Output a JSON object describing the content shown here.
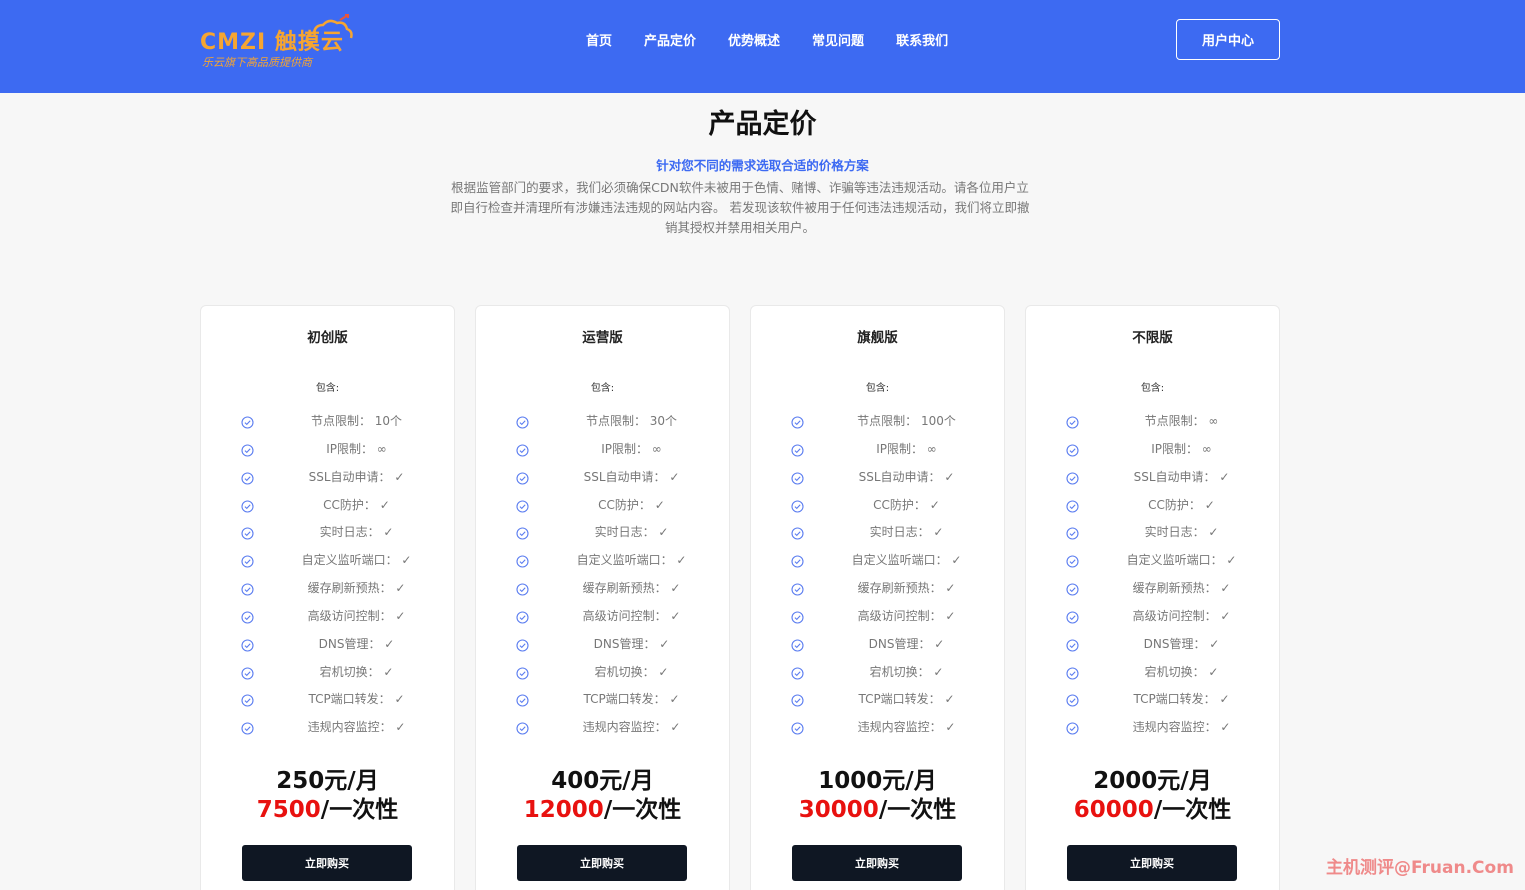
{
  "header": {
    "logo_text": "CMZI 触摸云",
    "logo_slogan": "乐云旗下高品质提供商",
    "nav": [
      "首页",
      "产品定价",
      "优势概述",
      "常见问题",
      "联系我们"
    ],
    "user_center": "用户中心",
    "bg_color": "#3d6af2"
  },
  "main": {
    "title": "产品定价",
    "subtitle": "针对您不同的需求选取合适的价格方案",
    "notice": "根据监管部门的要求，我们必须确保CDN软件未被用于色情、赌博、诈骗等违法违规活动。请各位用户立即自行检查并清理所有涉嫌违法违规的网站内容。 若发现该软件被用于任何违法违规活动，我们将立即撤销其授权并禁用相关用户。"
  },
  "plans": [
    {
      "name": "初创版",
      "contains": "包含:",
      "features": [
        "节点限制： 10个",
        "IP限制： ∞",
        "SSL自动申请： ✓",
        "CC防护： ✓",
        "实时日志： ✓",
        "自定义监听端口： ✓",
        "缓存刷新预热： ✓",
        "高级访问控制： ✓",
        "DNS管理： ✓",
        "宕机切换： ✓",
        "TCP端口转发： ✓",
        "违规内容监控： ✓"
      ],
      "price_month": "250元/月",
      "price_once_num": "7500",
      "price_once_suffix": "/一次性",
      "buy": "立即购买"
    },
    {
      "name": "运营版",
      "contains": "包含:",
      "features": [
        "节点限制： 30个",
        "IP限制： ∞",
        "SSL自动申请： ✓",
        "CC防护： ✓",
        "实时日志： ✓",
        "自定义监听端口： ✓",
        "缓存刷新预热： ✓",
        "高级访问控制： ✓",
        "DNS管理： ✓",
        "宕机切换： ✓",
        "TCP端口转发： ✓",
        "违规内容监控： ✓"
      ],
      "price_month": "400元/月",
      "price_once_num": "12000",
      "price_once_suffix": "/一次性",
      "buy": "立即购买"
    },
    {
      "name": "旗舰版",
      "contains": "包含:",
      "features": [
        "节点限制： 100个",
        "IP限制： ∞",
        "SSL自动申请： ✓",
        "CC防护： ✓",
        "实时日志： ✓",
        "自定义监听端口： ✓",
        "缓存刷新预热： ✓",
        "高级访问控制： ✓",
        "DNS管理： ✓",
        "宕机切换： ✓",
        "TCP端口转发： ✓",
        "违规内容监控： ✓"
      ],
      "price_month": "1000元/月",
      "price_once_num": "30000",
      "price_once_suffix": "/一次性",
      "buy": "立即购买"
    },
    {
      "name": "不限版",
      "contains": "包含:",
      "features": [
        "节点限制： ∞",
        "IP限制： ∞",
        "SSL自动申请： ✓",
        "CC防护： ✓",
        "实时日志： ✓",
        "自定义监听端口： ✓",
        "缓存刷新预热： ✓",
        "高级访问控制： ✓",
        "DNS管理： ✓",
        "宕机切换： ✓",
        "TCP端口转发： ✓",
        "违规内容监控： ✓"
      ],
      "price_month": "2000元/月",
      "price_once_num": "60000",
      "price_once_suffix": "/一次性",
      "buy": "立即购买"
    }
  ],
  "watermark": "主机测评@Fruan.Com"
}
